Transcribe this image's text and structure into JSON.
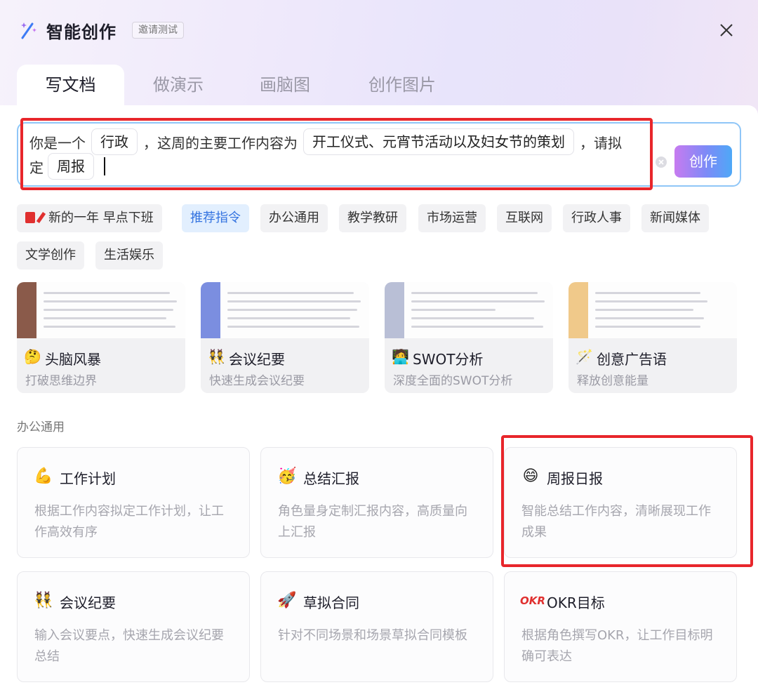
{
  "header": {
    "title": "智能创作",
    "badge": "邀请测试"
  },
  "tabs": [
    {
      "label": "写文档",
      "active": true
    },
    {
      "label": "做演示",
      "active": false
    },
    {
      "label": "画脑图",
      "active": false
    },
    {
      "label": "创作图片",
      "active": false
    }
  ],
  "prompt": {
    "text1": "你是一个",
    "chip1": "行政",
    "text2": "，这周的主要工作内容为",
    "chip2": "开工仪式、元宵节活动以及妇女节的策划",
    "text3": "，请拟",
    "text4": "定",
    "chip3": "周报",
    "create_label": "创作"
  },
  "categories": [
    {
      "label": "新的一年 早点下班",
      "active": false
    },
    {
      "label": "推荐指令",
      "active": true
    },
    {
      "label": "办公通用",
      "active": false
    },
    {
      "label": "教学教研",
      "active": false
    },
    {
      "label": "市场运营",
      "active": false
    },
    {
      "label": "互联网",
      "active": false
    },
    {
      "label": "行政人事",
      "active": false
    },
    {
      "label": "新闻媒体",
      "active": false
    },
    {
      "label": "文学创作",
      "active": false
    },
    {
      "label": "生活娱乐",
      "active": false
    }
  ],
  "templates": [
    {
      "icon": "thinking-face-icon",
      "emoji": "🤔",
      "title": "头脑风暴",
      "desc": "打破思维边界",
      "accent": "#8a5a4a"
    },
    {
      "icon": "people-icon",
      "emoji": "👯",
      "title": "会议纪要",
      "desc": "快速生成会议纪要",
      "accent": "#7b8ee0"
    },
    {
      "icon": "person-laptop-icon",
      "emoji": "🧑‍💻",
      "title": "SWOT分析",
      "desc": "深度全面的SWOT分析",
      "accent": "#b9bfd6"
    },
    {
      "icon": "magic-wand-icon",
      "emoji": "🪄",
      "title": "创意广告语",
      "desc": "释放创意能量",
      "accent": "#f0c98a"
    }
  ],
  "section_label": "办公通用",
  "features": [
    {
      "icon": "flexed-biceps-icon",
      "emoji": "💪",
      "title": "工作计划",
      "desc": "根据工作内容拟定工作计划，让工作高效有序"
    },
    {
      "icon": "party-face-icon",
      "emoji": "🥳",
      "title": "总结汇报",
      "desc": "角色量身定制汇报内容，高质量向上汇报"
    },
    {
      "icon": "grinning-face-icon",
      "emoji": "😄",
      "title": "周报日报",
      "desc": "智能总结工作内容，清晰展现工作成果"
    },
    {
      "icon": "people-icon",
      "emoji": "👯",
      "title": "会议纪要",
      "desc": "输入会议要点，快速生成会议纪要总结"
    },
    {
      "icon": "rocket-icon",
      "emoji": "🚀",
      "title": "草拟合同",
      "desc": "针对不同场景和场景草拟合同模板"
    },
    {
      "icon": "okr-icon",
      "emoji": "OKR",
      "title": "OKR目标",
      "desc": "根据角色撰写OKR，让工作目标明确可表达"
    }
  ]
}
